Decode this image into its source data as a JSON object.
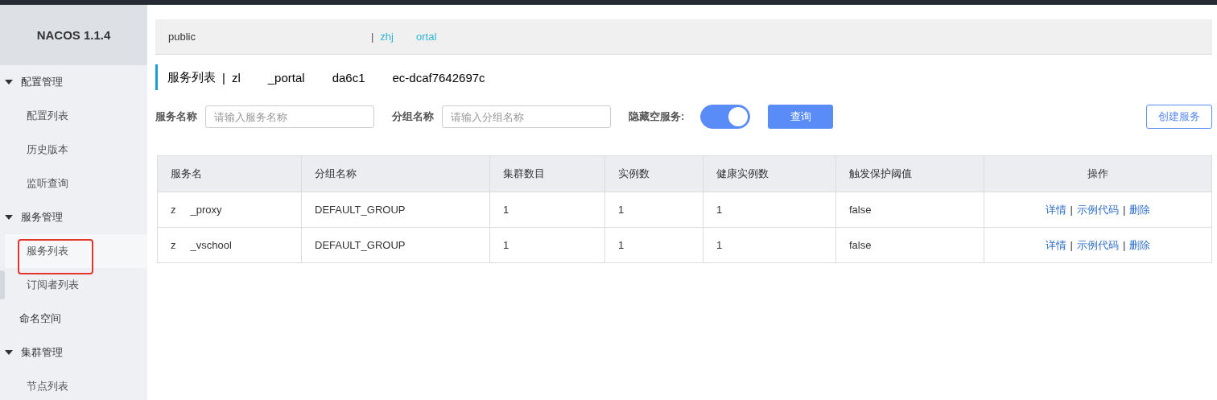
{
  "sidebar": {
    "title": "NACOS 1.1.4",
    "items": [
      {
        "kind": "group",
        "label": "配置管理",
        "expanded": true,
        "children": [
          {
            "label": "配置列表",
            "selected": false
          },
          {
            "label": "历史版本",
            "selected": false
          },
          {
            "label": "监听查询",
            "selected": false
          }
        ]
      },
      {
        "kind": "group",
        "label": "服务管理",
        "expanded": true,
        "children": [
          {
            "label": "服务列表",
            "selected": true
          },
          {
            "label": "订阅者列表",
            "selected": false
          }
        ]
      },
      {
        "kind": "link",
        "label": "命名空间"
      },
      {
        "kind": "group",
        "label": "集群管理",
        "expanded": true,
        "children": [
          {
            "label": "节点列表",
            "selected": false
          }
        ]
      }
    ]
  },
  "namespace_bar": {
    "items": [
      {
        "label": "public",
        "selected": false
      },
      {
        "separator": "|",
        "label_parts": [
          "zhj",
          "ortal"
        ],
        "selected": true
      }
    ]
  },
  "page_title": {
    "title": "服务列表",
    "separator": "|",
    "id_parts": [
      "zl",
      "_portal",
      "da6c1",
      "ec-dcaf7642697c"
    ]
  },
  "filters": {
    "service_label": "服务名称",
    "service_placeholder": "请输入服务名称",
    "group_label": "分组名称",
    "group_placeholder": "请输入分组名称",
    "hide_empty_label": "隐藏空服务:",
    "hide_empty_on": true,
    "query_button": "查询",
    "create_button": "创建服务"
  },
  "table": {
    "columns": [
      "服务名",
      "分组名称",
      "集群数目",
      "实例数",
      "健康实例数",
      "触发保护阈值",
      "操作"
    ],
    "rows": [
      {
        "name_parts": [
          "z",
          "_proxy"
        ],
        "group": "DEFAULT_GROUP",
        "clusters": "1",
        "instances": "1",
        "healthy": "1",
        "threshold": "false",
        "actions": [
          "详情",
          "示例代码",
          "删除"
        ],
        "action_separators": [
          "|",
          "|"
        ]
      },
      {
        "name_parts": [
          "z",
          "_vschool"
        ],
        "group": "DEFAULT_GROUP",
        "clusters": "1",
        "instances": "1",
        "healthy": "1",
        "threshold": "false",
        "actions": [
          "详情",
          "示例代码",
          "删除"
        ],
        "action_separators": [
          "|",
          "|"
        ]
      }
    ]
  }
}
